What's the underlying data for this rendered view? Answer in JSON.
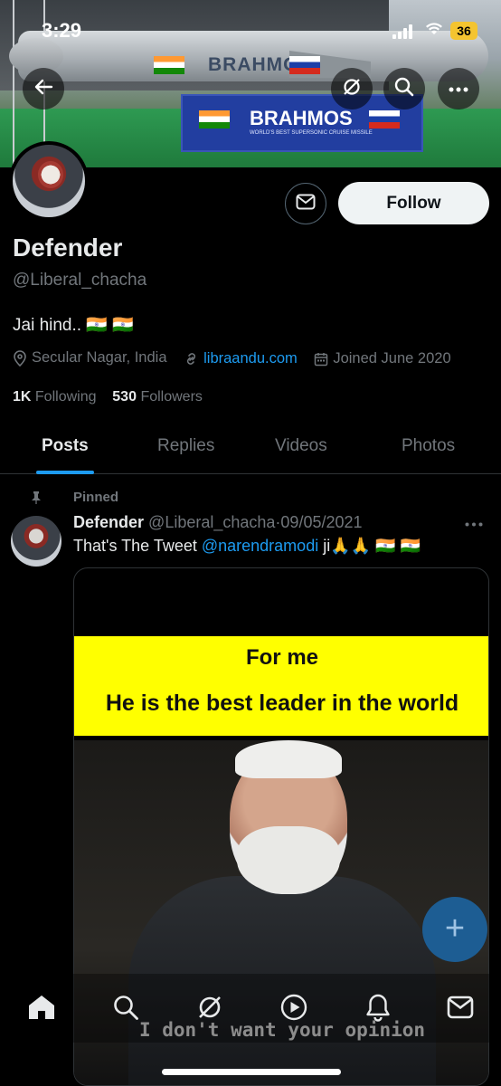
{
  "status_bar": {
    "time": "3:29",
    "battery": "36"
  },
  "banner": {
    "missile_text": "BRAHMOS",
    "sign_text": "BRAHMOS",
    "sign_subtext": "WORLD'S BEST SUPERSONIC CRUISE MISSILE"
  },
  "profile": {
    "name": "Defender",
    "handle": "@Liberal_chacha",
    "bio": "Jai hind.. 🇮🇳 🇮🇳",
    "location": "Secular Nagar, India",
    "website": "libraandu.com",
    "joined": "Joined June 2020",
    "following_count": "1K",
    "following_label": "Following",
    "followers_count": "530",
    "followers_label": "Followers",
    "follow_button": "Follow"
  },
  "tabs": [
    {
      "label": "Posts",
      "active": true
    },
    {
      "label": "Replies"
    },
    {
      "label": "Videos"
    },
    {
      "label": "Photos"
    }
  ],
  "post": {
    "pinned_label": "Pinned",
    "author_name": "Defender",
    "author_handle": "@Liberal_chacha",
    "separator": "·",
    "date": "09/05/2021",
    "text_before": "That's The Tweet ",
    "mention": "@narendramodi",
    "text_after": " ji🙏🙏 🇮🇳 🇮🇳",
    "media": {
      "line1": "For me",
      "line2": "He is the  best leader in the world",
      "caption": "I don't want your opinion"
    }
  },
  "fab_label": "+",
  "icons": [
    "back-icon",
    "no-lens-icon",
    "search-icon",
    "more-icon",
    "mail-icon",
    "location-icon",
    "link-icon",
    "calendar-icon",
    "pin-icon",
    "home-icon",
    "grok-icon",
    "play-icon",
    "bell-icon"
  ],
  "colors": {
    "accent": "#1d9bf0",
    "follow_bg": "#eff3f4",
    "muted": "#71767b",
    "meme_yellow": "#ffff00"
  }
}
